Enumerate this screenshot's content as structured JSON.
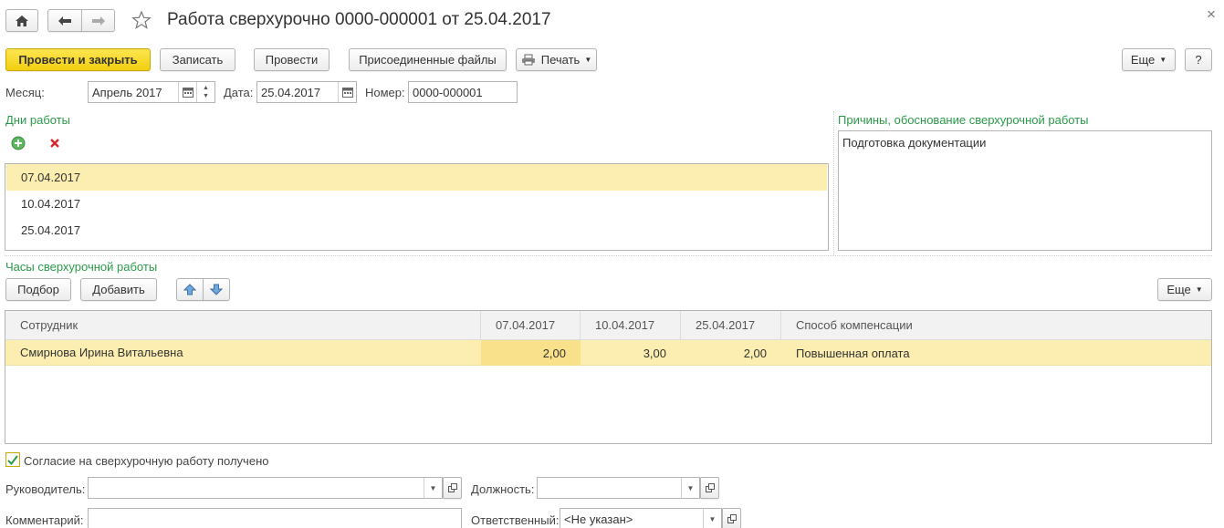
{
  "header": {
    "title": "Работа сверхурочно 0000-000001 от 25.04.2017",
    "close_glyph": "×"
  },
  "toolbar": {
    "post_close_label": "Провести и закрыть",
    "save_label": "Записать",
    "post_label": "Провести",
    "attached_files_label": "Присоединенные файлы",
    "print_label": "Печать",
    "more_label": "Еще",
    "help_label": "?"
  },
  "fields": {
    "month_label": "Месяц:",
    "month_value": "Апрель 2017",
    "date_label": "Дата:",
    "date_value": "25.04.2017",
    "number_label": "Номер:",
    "number_value": "0000-000001"
  },
  "work_days": {
    "title": "Дни работы",
    "items": [
      "07.04.2017",
      "10.04.2017",
      "25.04.2017"
    ]
  },
  "reasons": {
    "title": "Причины, обоснование сверхурочной работы",
    "text": "Подготовка документации"
  },
  "hours": {
    "title": "Часы сверхурочной работы",
    "select_label": "Подбор",
    "add_label": "Добавить",
    "more_label": "Еще",
    "columns": [
      "Сотрудник",
      "07.04.2017",
      "10.04.2017",
      "25.04.2017",
      "Способ компенсации"
    ],
    "rows": [
      {
        "employee": "Смирнова Ирина Витальевна",
        "d1": "2,00",
        "d2": "3,00",
        "d3": "2,00",
        "compensation": "Повышенная оплата"
      }
    ]
  },
  "footer": {
    "consent_label": "Согласие на сверхурочную работу получено",
    "consent_checked": true,
    "manager_label": "Руководитель:",
    "manager_value": "",
    "position_label": "Должность:",
    "position_value": "",
    "comment_label": "Комментарий:",
    "comment_value": "",
    "responsible_label": "Ответственный:",
    "responsible_value": "<Не указан>"
  },
  "colors": {
    "primary_button": "#f2cf11",
    "selected_row": "#fbeeb0",
    "selected_cell": "#f9e08a",
    "group_title": "#2a9a48"
  }
}
